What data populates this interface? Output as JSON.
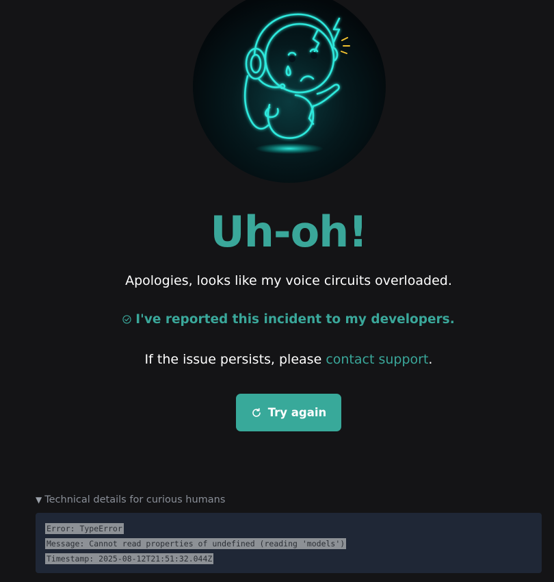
{
  "hero": {
    "title": "Uh-oh!",
    "apology": "Apologies, looks like my voice circuits overloaded.",
    "reported": "I've reported this incident to my developers.",
    "persist_prefix": "If the issue persists, please ",
    "support_link": "contact support",
    "persist_suffix": ".",
    "illustration_icon": "sad-robot-with-headset-icon"
  },
  "retry_button": {
    "label": "Try again",
    "icon": "refresh-icon"
  },
  "details": {
    "summary": "Technical details for curious humans",
    "expanded": true,
    "lines": [
      "Error: TypeError",
      "Message: Cannot read properties of undefined (reading 'models')",
      "Timestamp: 2025-08-12T21:51:32.044Z"
    ]
  },
  "colors": {
    "background": "#141416",
    "accent": "#3aa79a",
    "details_background": "#1f2736"
  }
}
